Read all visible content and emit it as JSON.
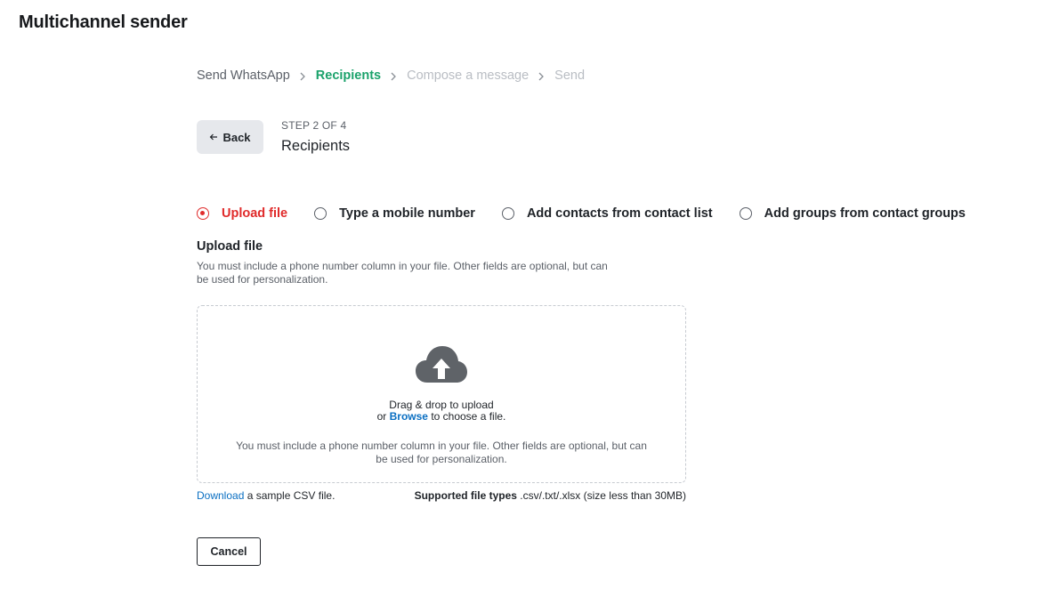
{
  "app": {
    "title": "Multichannel sender"
  },
  "breadcrumb": [
    {
      "label": "Send WhatsApp",
      "state": "done"
    },
    {
      "label": "Recipients",
      "state": "active"
    },
    {
      "label": "Compose a message",
      "state": "future"
    },
    {
      "label": "Send",
      "state": "future"
    }
  ],
  "header": {
    "back_label": "Back",
    "step_label": "STEP 2 OF 4",
    "step_title": "Recipients"
  },
  "recipient_options": [
    {
      "label": "Upload file",
      "checked": true
    },
    {
      "label": "Type a mobile number",
      "checked": false
    },
    {
      "label": "Add contacts from contact list",
      "checked": false
    },
    {
      "label": "Add groups from contact groups",
      "checked": false
    }
  ],
  "upload": {
    "title": "Upload file",
    "help": "You must include a phone number column in your file. Other fields are optional, but can be used for personalization.",
    "drop_line1": "Drag & drop to upload",
    "drop_prefix": "or ",
    "browse_label": "Browse",
    "drop_suffix": " to choose a file.",
    "drop_note": "You must include a phone number column in your file. Other fields are optional, but can be used for personalization.",
    "download_label": "Download",
    "download_suffix": " a sample CSV file.",
    "filetypes_label": "Supported file types",
    "filetypes_value": " .csv/.txt/.xlsx (size less than 30MB)"
  },
  "footer": {
    "cancel_label": "Cancel"
  },
  "colors": {
    "active_step": "#1ba26b",
    "selected_radio": "#e02b2b",
    "link": "#0a6fc2",
    "cloud_icon": "#5f6368"
  },
  "icons": {
    "back": "arrow-left-icon",
    "separator": "chevron-right-icon",
    "upload": "cloud-upload-icon"
  }
}
